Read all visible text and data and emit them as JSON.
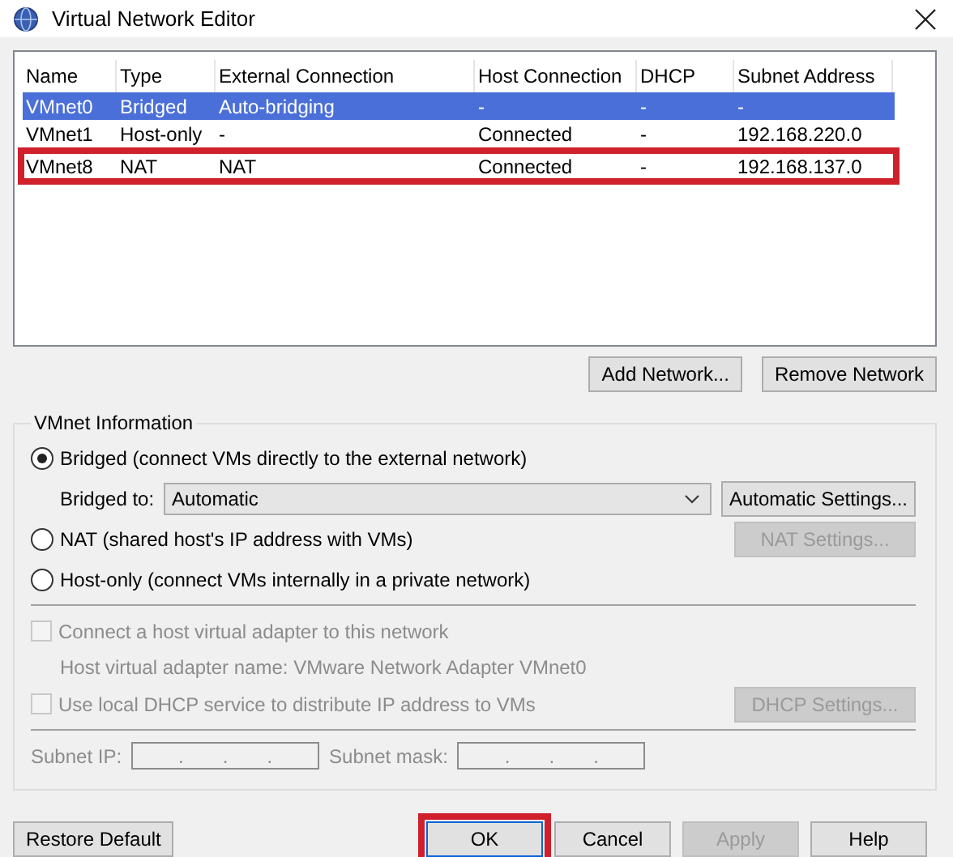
{
  "window": {
    "title": "Virtual Network Editor"
  },
  "table": {
    "columns": [
      "Name",
      "Type",
      "External Connection",
      "Host Connection",
      "DHCP",
      "Subnet Address"
    ],
    "rows": [
      {
        "cells": [
          "VMnet0",
          "Bridged",
          "Auto-bridging",
          "-",
          "-",
          "-"
        ],
        "selected": true,
        "highlighted": false
      },
      {
        "cells": [
          "VMnet1",
          "Host-only",
          "-",
          "Connected",
          "-",
          "192.168.220.0"
        ],
        "selected": false,
        "highlighted": false
      },
      {
        "cells": [
          "VMnet8",
          "NAT",
          "NAT",
          "Connected",
          "-",
          "192.168.137.0"
        ],
        "selected": false,
        "highlighted": true
      }
    ]
  },
  "table_buttons": [
    "Add Network...",
    "Remove Network"
  ],
  "vmnet_info": {
    "title": "VMnet Information",
    "bridged": {
      "label": "Bridged (connect VMs directly to the external network)",
      "selected": true
    },
    "bridged_to": {
      "label": "Bridged to:",
      "value": "Automatic"
    },
    "automatic_settings": {
      "label": "Automatic Settings...",
      "disabled": false
    },
    "nat": {
      "label": "NAT (shared host's IP address with VMs)",
      "selected": false
    },
    "nat_settings": {
      "label": "NAT Settings...",
      "disabled": true
    },
    "host_only": {
      "label": "Host-only (connect VMs internally in a private network)",
      "selected": false
    },
    "connect_adapter": {
      "label": "Connect a host virtual adapter to this network",
      "checked": false,
      "disabled": true
    },
    "adapter_name": {
      "text": "Host virtual adapter name: VMware Network Adapter VMnet0",
      "disabled": true
    },
    "dhcp": {
      "label": "Use local DHCP service to distribute IP address to VMs",
      "checked": false,
      "disabled": true
    },
    "dhcp_settings": {
      "label": "DHCP Settings...",
      "disabled": true
    },
    "subnet_ip": {
      "label": "Subnet IP:",
      "separators": [
        ".",
        ".",
        "."
      ],
      "disabled": true
    },
    "subnet_mask": {
      "label": "Subnet mask:",
      "separators": [
        ".",
        ".",
        "."
      ],
      "disabled": true
    }
  },
  "buttons": [
    {
      "label": "Restore Default",
      "disabled": false,
      "highlighted": false
    },
    {
      "label": "OK",
      "disabled": false,
      "highlighted": true
    },
    {
      "label": "Cancel",
      "disabled": false,
      "highlighted": false
    },
    {
      "label": "Apply",
      "disabled": true,
      "highlighted": false
    },
    {
      "label": "Help",
      "disabled": false,
      "highlighted": false
    }
  ]
}
